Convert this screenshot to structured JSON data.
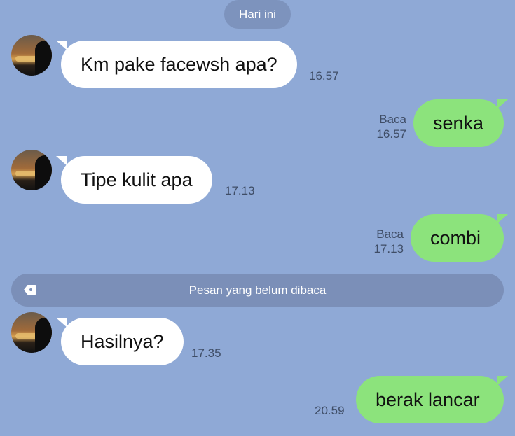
{
  "header": {
    "day_label": "Hari ini"
  },
  "messages": [
    {
      "direction": "in",
      "text": "Km pake facewsh apa?",
      "time": "16.57"
    },
    {
      "direction": "out",
      "text": "senka",
      "status": "Baca",
      "time": "16.57"
    },
    {
      "direction": "in",
      "text": "Tipe kulit apa",
      "time": "17.13"
    },
    {
      "direction": "out",
      "text": "combi",
      "status": "Baca",
      "time": "17.13"
    },
    {
      "direction": "in",
      "text": "Hasilnya?",
      "time": "17.35"
    },
    {
      "direction": "out",
      "text": "berak lancar",
      "time": "20.59"
    }
  ],
  "unread_divider": {
    "label": "Pesan yang belum dibaca"
  },
  "colors": {
    "background": "#8fa9d6",
    "incoming_bubble": "#ffffff",
    "outgoing_bubble": "#8ce37c",
    "divider": "#7b8fb8"
  }
}
